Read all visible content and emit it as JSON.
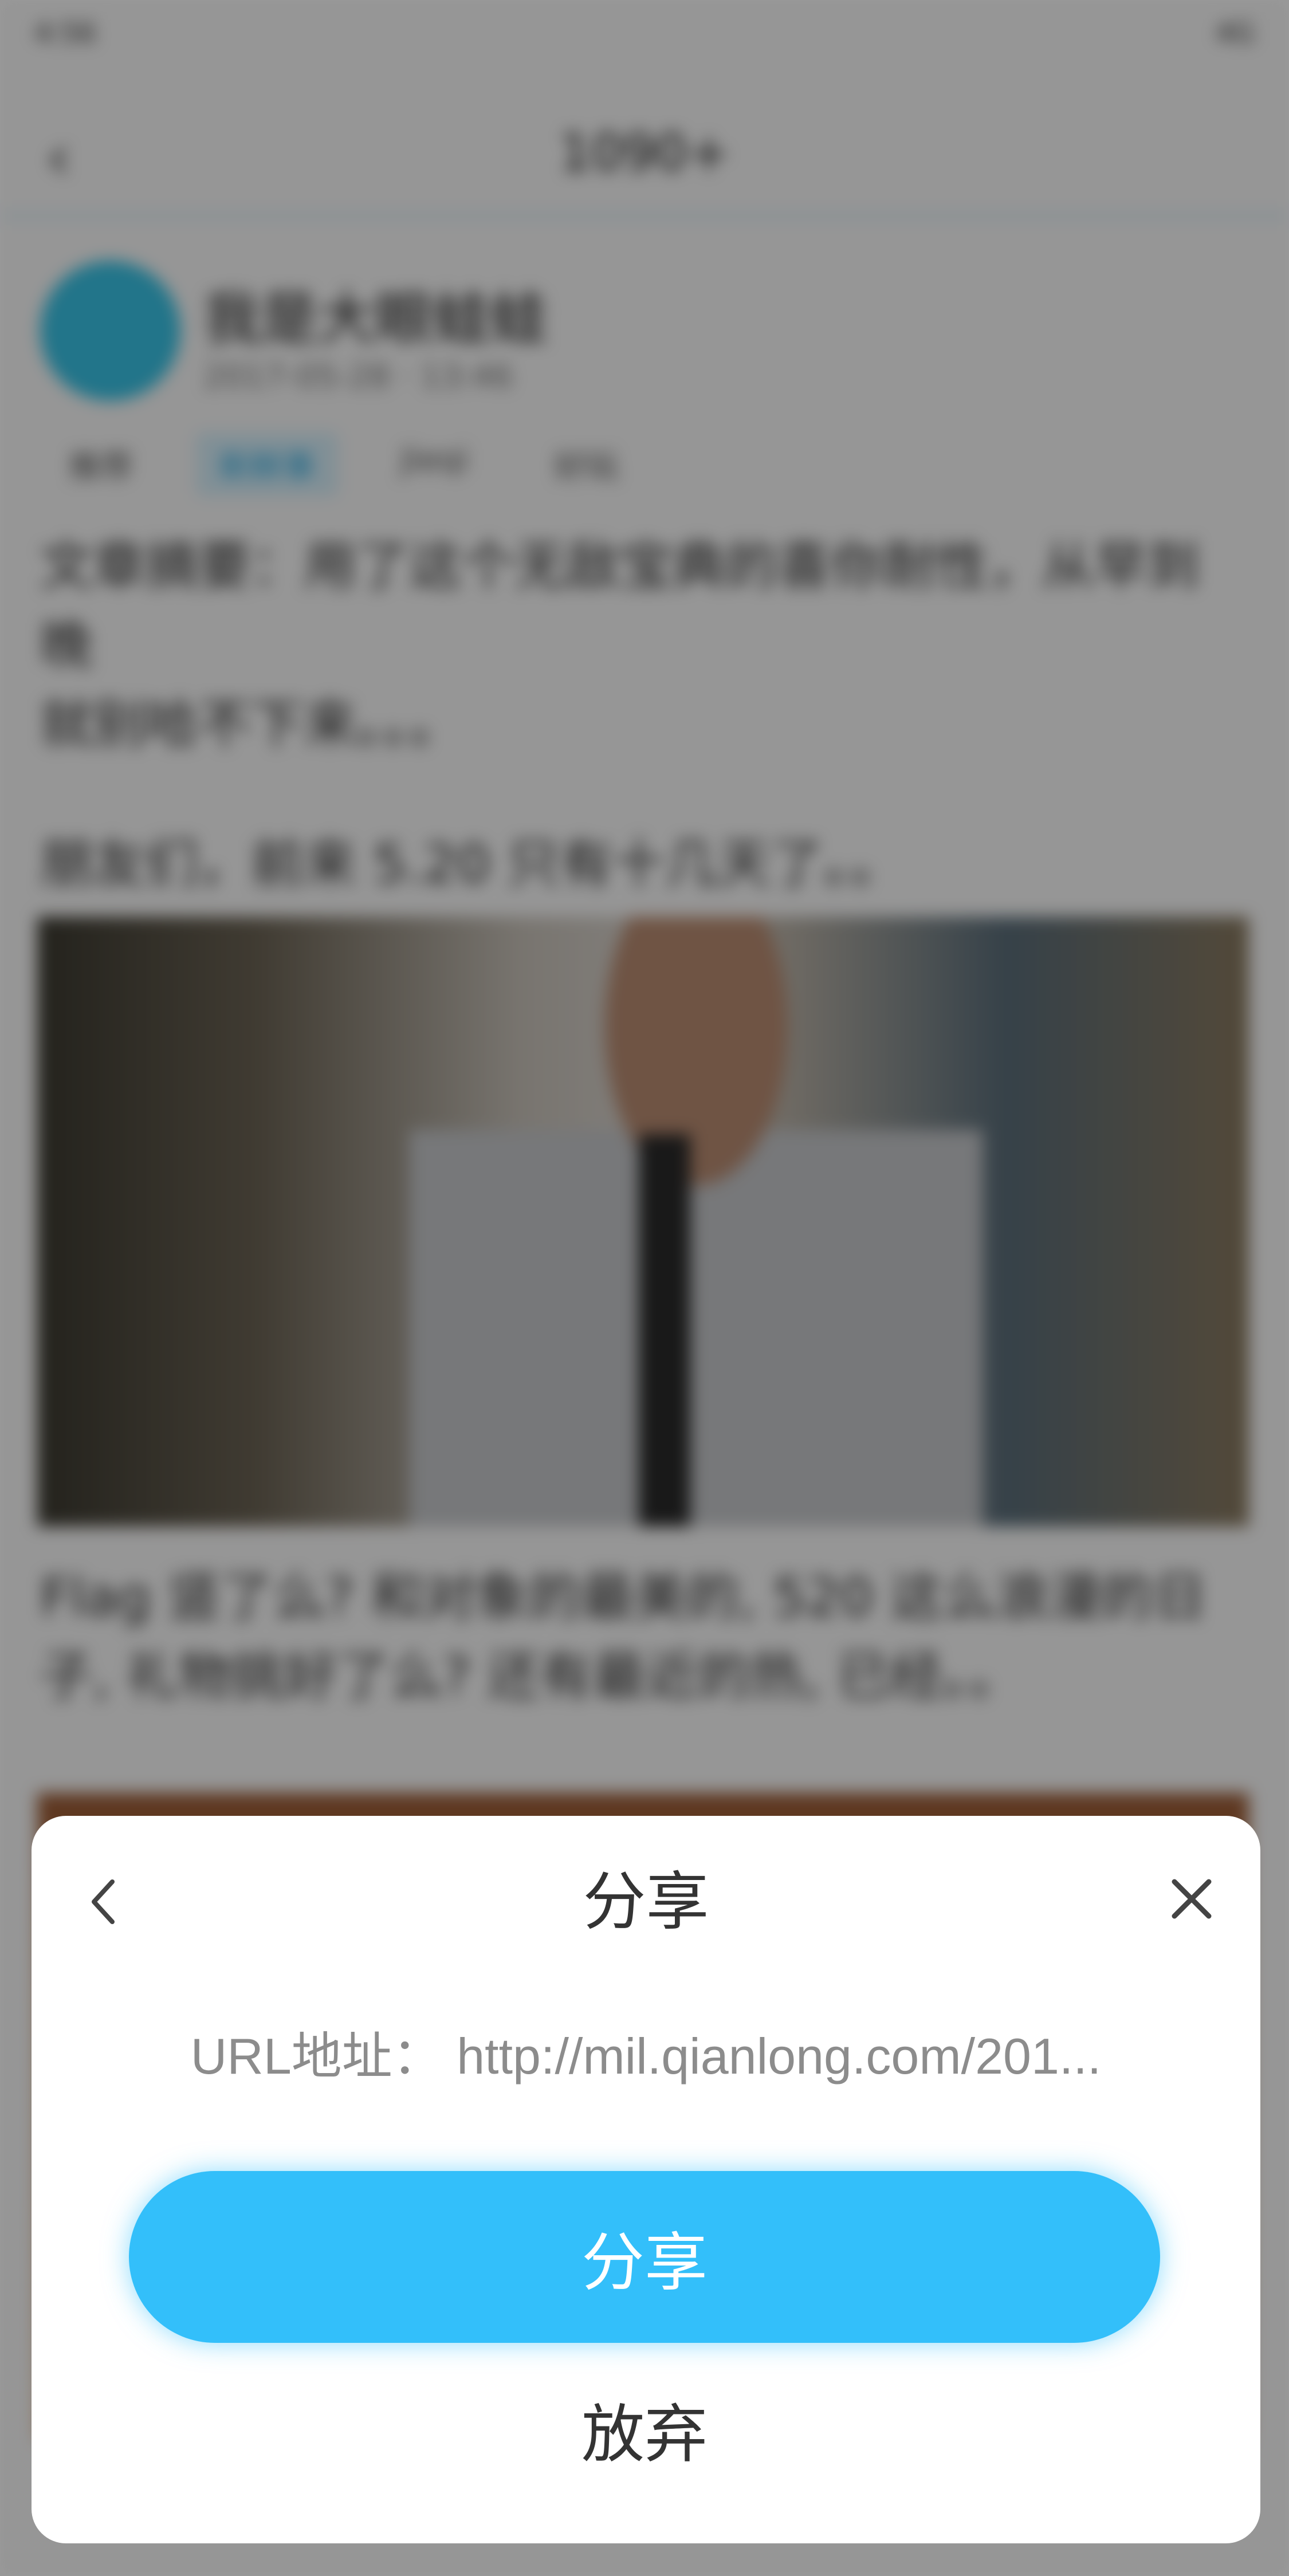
{
  "background_page": {
    "status_left": "4:56",
    "status_right": "4G",
    "nav_title": "1090+",
    "author_name": "我是大眼蛙蛙",
    "post_meta": "2017-05-28 · 13:46",
    "tags": [
      "推荐",
      "新鲜事",
      "Jieqi",
      "好玩"
    ],
    "paragraph1": "文章摘要：用了这个无敌宝典的喜你耐性，从早到晚",
    "paragraph1b": "就别哈不下来。。。",
    "paragraph2": "朋友们，前来 5.20 只有十几天了。。",
    "paragraph3": "Flag 竖了么? 和对象的最美的, 520 这么浪漫的日子, 礼物挑好了么? 还有最近的热, 已经。。"
  },
  "dialog": {
    "title": "分享",
    "url_label": "URL地址：",
    "url_value": "http://mil.qianlong.com/201...",
    "share_label": "分享",
    "cancel_label": "放弃",
    "icons": {
      "back": "chevron-left-icon",
      "close": "close-icon"
    },
    "colors": {
      "accent": "#33bffa",
      "title_text": "#333333",
      "url_text": "#8c8c8c"
    }
  }
}
